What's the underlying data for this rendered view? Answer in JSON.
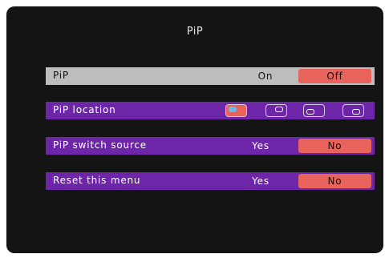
{
  "menu": {
    "title": "PiP",
    "pip": {
      "label": "PiP",
      "option_a": "On",
      "option_b": "Off",
      "selected": "Off"
    },
    "pip_location": {
      "label": "PiP location",
      "options": [
        "top-left",
        "top-right",
        "bottom-left",
        "bottom-right"
      ],
      "selected": "top-left"
    },
    "pip_switch_source": {
      "label": "PiP switch source",
      "option_a": "Yes",
      "option_b": "No",
      "selected": "No"
    },
    "reset_menu": {
      "label": "Reset this menu",
      "option_a": "Yes",
      "option_b": "No",
      "selected": "No"
    }
  },
  "colors": {
    "background": "#141414",
    "highlight_row": "#bdbdbd",
    "row": "#6e26a8",
    "selected_option": "#e8635c",
    "location_marker": "#6fb7e8"
  }
}
